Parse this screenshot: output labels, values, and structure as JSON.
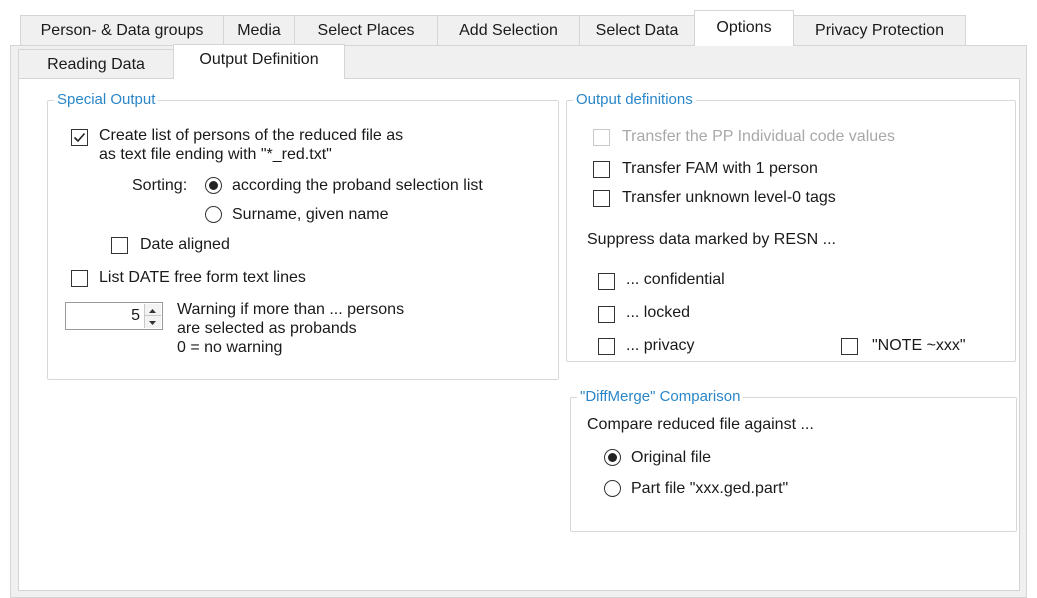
{
  "tabs": [
    {
      "label": "Person- & Data groups"
    },
    {
      "label": "Media"
    },
    {
      "label": "Select Places"
    },
    {
      "label": "Add Selection"
    },
    {
      "label": "Select Data"
    },
    {
      "label": "Options"
    },
    {
      "label": "Privacy Protection"
    }
  ],
  "active_tab": "Options",
  "subtabs": [
    {
      "label": "Reading Data"
    },
    {
      "label": "Output Definition"
    }
  ],
  "active_subtab": "Output Definition",
  "special_output": {
    "title": "Special Output",
    "create_list": {
      "line1": "Create list of persons of the reduced file as",
      "line2": "as text file ending with \"*_red.txt\"",
      "checked": true
    },
    "sorting_label": "Sorting:",
    "sort_options": [
      {
        "label": "according the proband selection list",
        "selected": true
      },
      {
        "label": "Surname, given name",
        "selected": false
      }
    ],
    "date_aligned": {
      "label": "Date aligned",
      "checked": false
    },
    "list_date": {
      "label": "List DATE free form text lines",
      "checked": false
    },
    "warning_value": "5",
    "warning_line1": "Warning if more than ... persons",
    "warning_line2": "are selected as probands",
    "warning_line3": "0 = no warning"
  },
  "output_definitions": {
    "title": "Output definitions",
    "transfer_pp": {
      "label": "Transfer the PP Individual code values",
      "checked": false,
      "enabled": false
    },
    "transfer_fam": {
      "label": "Transfer FAM with 1 person",
      "checked": false
    },
    "transfer_unknown": {
      "label": "Transfer unknown level-0 tags",
      "checked": false
    },
    "suppress_label": "Suppress data marked by RESN ...",
    "confidential": {
      "label": "... confidential",
      "checked": false
    },
    "locked": {
      "label": "... locked",
      "checked": false
    },
    "privacy": {
      "label": "... privacy",
      "checked": false
    },
    "note": {
      "label": "\"NOTE ~xxx\"",
      "checked": false
    }
  },
  "diffmerge": {
    "title": "\"DiffMerge\" Comparison",
    "compare_label": "Compare reduced file against ...",
    "options": [
      {
        "label": "Original file",
        "selected": true
      },
      {
        "label": "Part file \"xxx.ged.part\"",
        "selected": false
      }
    ]
  }
}
